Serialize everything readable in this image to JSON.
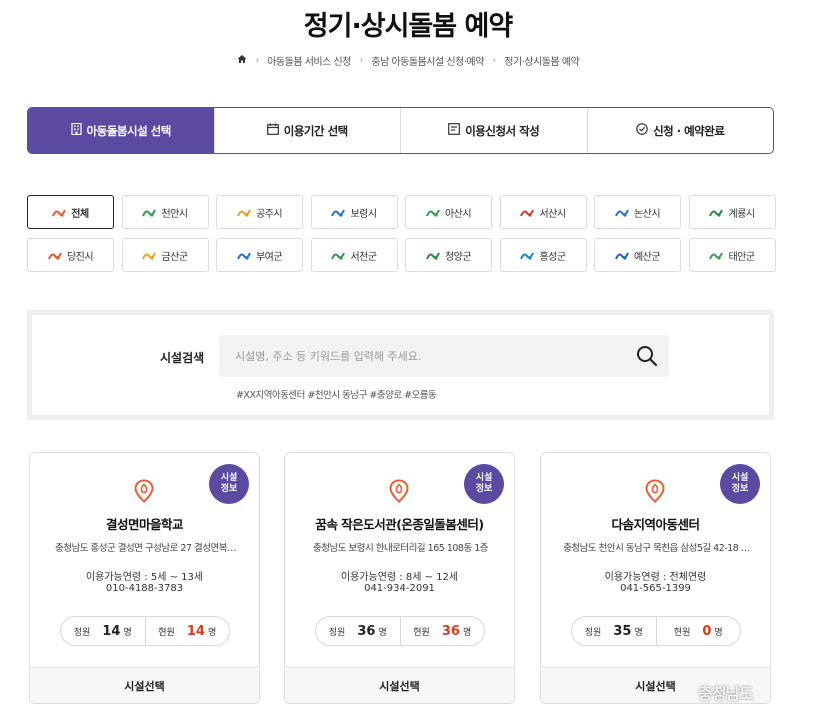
{
  "page": {
    "title": "정기·상시돌봄 예약",
    "breadcrumb": [
      "아동돌봄 서비스 신청",
      "충남 아동돌봄시설 신청·예약",
      "정기·상시돌봄 예약"
    ]
  },
  "steps": [
    {
      "label": "아동돌봄시설 선택",
      "icon": "building-icon"
    },
    {
      "label": "이용기간 선택",
      "icon": "calendar-icon"
    },
    {
      "label": "이용신청서 작성",
      "icon": "form-icon"
    },
    {
      "label": "신청 · 예약완료",
      "icon": "check-circle-icon"
    }
  ],
  "regions": [
    {
      "label": "전체",
      "color": "#e85a2a",
      "active": true
    },
    {
      "label": "천안시",
      "color": "#2a9d4a"
    },
    {
      "label": "공주시",
      "color": "#e8a020"
    },
    {
      "label": "보령시",
      "color": "#1e6fd0"
    },
    {
      "label": "아산시",
      "color": "#2aa050"
    },
    {
      "label": "서산시",
      "color": "#d83a2a"
    },
    {
      "label": "논산시",
      "color": "#2a70c0"
    },
    {
      "label": "계룡시",
      "color": "#2a8a4a"
    },
    {
      "label": "당진시",
      "color": "#e0542a"
    },
    {
      "label": "금산군",
      "color": "#e8a020"
    },
    {
      "label": "부여군",
      "color": "#1e6fd0"
    },
    {
      "label": "서천군",
      "color": "#2a9a4a"
    },
    {
      "label": "청양군",
      "color": "#2a8a40"
    },
    {
      "label": "홍성군",
      "color": "#1a8ab8"
    },
    {
      "label": "예산군",
      "color": "#1e60c0"
    },
    {
      "label": "태안군",
      "color": "#3aa050"
    }
  ],
  "search": {
    "label": "시설검색",
    "placeholder": "시설명, 주소 등 키워드를 입력해 주세요.",
    "tags": "#XX지역아동센터 #천안시 동남구 #충양로 #오룡동"
  },
  "cards": [
    {
      "badge": [
        "시설",
        "정보"
      ],
      "name": "결성면마을학교",
      "address": "충청남도 홍성군 결성면 구성남로 27 결성면복…",
      "age": "이용가능연령 : 5세 ~ 13세",
      "phone": "010-4188-3783",
      "capacity_label": "정원",
      "capacity": "14",
      "capacity_unit": "명",
      "current_label": "현원",
      "current": "14",
      "current_unit": "명",
      "button": "시설선택"
    },
    {
      "badge": [
        "시설",
        "정보"
      ],
      "name": "꿈속 작은도서관(온종일돌봄센터)",
      "address": "충청남도 보령시 한내로터리길 165 108동 1층",
      "age": "이용가능연령 : 8세 ~ 12세",
      "phone": "041-934-2091",
      "capacity_label": "정원",
      "capacity": "36",
      "capacity_unit": "명",
      "current_label": "현원",
      "current": "36",
      "current_unit": "명",
      "button": "시설선택"
    },
    {
      "badge": [
        "시설",
        "정보"
      ],
      "name": "다솜지역아동센터",
      "address": "충청남도 천안시 동남구 목천읍 삼성5길 42-18 …",
      "age": "이용가능연령 : 전체연령",
      "phone": "041-565-1399",
      "capacity_label": "정원",
      "capacity": "35",
      "capacity_unit": "명",
      "current_label": "현원",
      "current": "0",
      "current_unit": "명",
      "button": "시설선택"
    }
  ],
  "watermark": "충청남도",
  "colors": {
    "accent": "#5b4a9f",
    "current_count": "#d83a1a",
    "pin": "#e8603a"
  }
}
